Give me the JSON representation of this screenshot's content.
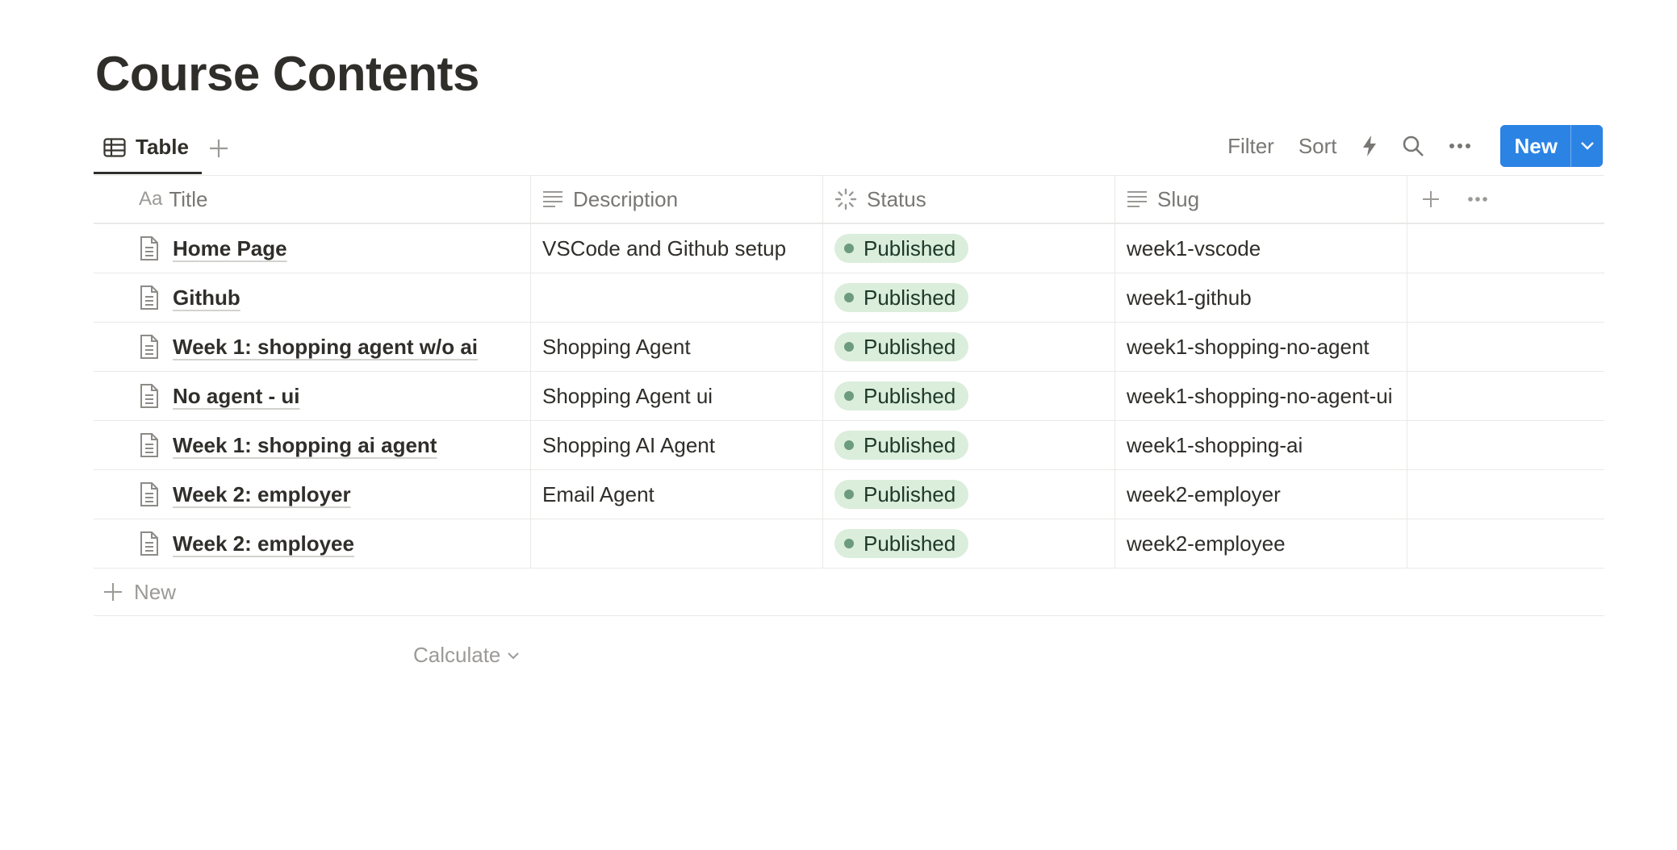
{
  "page": {
    "title": "Course Contents"
  },
  "views": {
    "active_label": "Table"
  },
  "toolbar": {
    "filter_label": "Filter",
    "sort_label": "Sort",
    "new_label": "New"
  },
  "columns": {
    "title": {
      "prefix": "Aa",
      "label": "Title"
    },
    "description": {
      "label": "Description"
    },
    "status": {
      "label": "Status"
    },
    "slug": {
      "label": "Slug"
    }
  },
  "rows": [
    {
      "title": "Home Page",
      "description": "VSCode and Github setup",
      "status": "Published",
      "slug": "week1-vscode"
    },
    {
      "title": "Github",
      "description": "",
      "status": "Published",
      "slug": "week1-github"
    },
    {
      "title": "Week 1: shopping agent w/o ai",
      "description": "Shopping Agent",
      "status": "Published",
      "slug": "week1-shopping-no-agent"
    },
    {
      "title": "No agent - ui",
      "description": "Shopping Agent ui",
      "status": "Published",
      "slug": "week1-shopping-no-agent-ui"
    },
    {
      "title": "Week 1: shopping ai agent",
      "description": "Shopping AI Agent",
      "status": "Published",
      "slug": "week1-shopping-ai"
    },
    {
      "title": "Week 2: employer",
      "description": "Email Agent",
      "status": "Published",
      "slug": "week2-employer"
    },
    {
      "title": "Week 2: employee",
      "description": "",
      "status": "Published",
      "slug": "week2-employee"
    }
  ],
  "table_footer": {
    "new_row_label": "New",
    "calculate_label": "Calculate"
  },
  "colors": {
    "accent": "#2b83e4",
    "status_published_bg": "#dbeddb",
    "status_published_dot": "#6c9b7d"
  }
}
